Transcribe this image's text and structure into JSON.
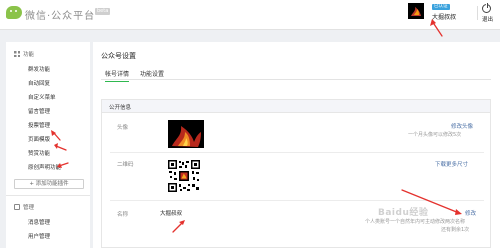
{
  "header": {
    "brand": "微信·公众平台",
    "beta": "beta",
    "verified_badge": "已认证",
    "account_name": "大掘叔叔",
    "exit_label": "退出"
  },
  "sidebar": {
    "section1": "功能",
    "items1": [
      "群发功能",
      "自动回复",
      "自定义菜单",
      "留言管理",
      "投票管理",
      "页面模版",
      "赞赏功能",
      "原创声明功能"
    ],
    "add_plugin": "+ 添加功能插件",
    "section2": "管理",
    "items2": [
      "消息管理",
      "用户管理"
    ]
  },
  "main": {
    "title": "公众号设置",
    "tabs": [
      "帐号详情",
      "功能设置"
    ],
    "panel_title": "公开信息",
    "rows": {
      "avatar_label": "头像",
      "avatar_action": "修改头像",
      "avatar_hint": "一个月头像可以修改5次",
      "qr_label": "二维码",
      "qr_action": "下载更多尺寸",
      "name_label": "名称",
      "name_value": "大掘叔叔",
      "name_action": "修改",
      "name_hint": "个人类账号一个自然年内可主动修改两次名称",
      "name_hint2": "还有剩余1次"
    }
  },
  "watermark": "Baidu经验",
  "colors": {
    "accent_green": "#2fb84f",
    "link_blue": "#4a6fa5",
    "annotation_red": "#e4322e"
  }
}
